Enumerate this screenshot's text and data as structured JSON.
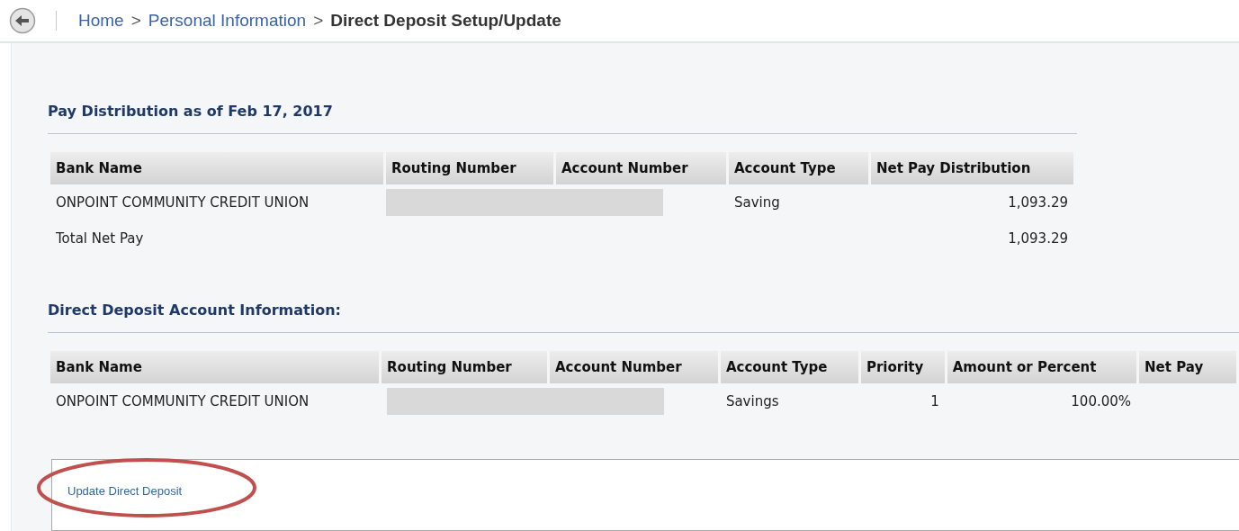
{
  "breadcrumb": [
    {
      "label": "Home",
      "kind": "link"
    },
    {
      "label": ">",
      "kind": "separator"
    },
    {
      "label": "Personal Information",
      "kind": "link"
    },
    {
      "label": ">",
      "kind": "separator"
    },
    {
      "label": "Direct Deposit Setup/Update",
      "kind": "current"
    }
  ],
  "pay_distribution": {
    "title": "Pay Distribution as of Feb 17, 2017",
    "columns": [
      "Bank Name",
      "Routing Number",
      "Account Number",
      "Account Type",
      "Net Pay Distribution"
    ],
    "rows": [
      {
        "bank_name": "ONPOINT COMMUNITY CREDIT UNION",
        "account_details_redacted": true,
        "account_type": "Saving",
        "net_pay_distribution": "1,093.29"
      },
      {
        "bank_name": "Total Net Pay",
        "account_details_redacted": false,
        "account_type": "",
        "net_pay_distribution": "1,093.29"
      }
    ]
  },
  "direct_deposit": {
    "title": "Direct Deposit Account Information:",
    "columns": [
      "Bank Name",
      "Routing Number",
      "Account Number",
      "Account Type",
      "Priority",
      "Amount or Percent",
      "Net Pay"
    ],
    "rows": [
      {
        "bank_name": "ONPOINT COMMUNITY CREDIT UNION",
        "account_details_redacted": true,
        "account_type": "Savings",
        "priority": "1",
        "amount_or_percent": "100.00%"
      }
    ]
  },
  "update_link": {
    "label": "Update Direct Deposit",
    "highlighted": true
  }
}
